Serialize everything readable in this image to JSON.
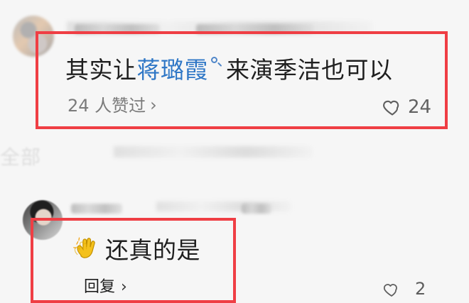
{
  "comments": [
    {
      "text_prefix": "其实让",
      "highlight_text": "蒋璐霞",
      "text_suffix": "来演季洁也可以",
      "liked_by_text": "24 人赞过",
      "like_count": "24"
    },
    {
      "text": "还真的是",
      "reply_label": "回复",
      "like_count": "2"
    }
  ],
  "section_ghost_text": "全部",
  "colors": {
    "highlight": "#2f77c6",
    "box": "#ef3e44",
    "text": "#1f1f1f",
    "muted": "#7b7b7b"
  },
  "icons": {
    "search": "search-icon",
    "heart": "heart-icon",
    "clap": "clapping-hands-icon",
    "chevron": "chevron-right-icon"
  }
}
